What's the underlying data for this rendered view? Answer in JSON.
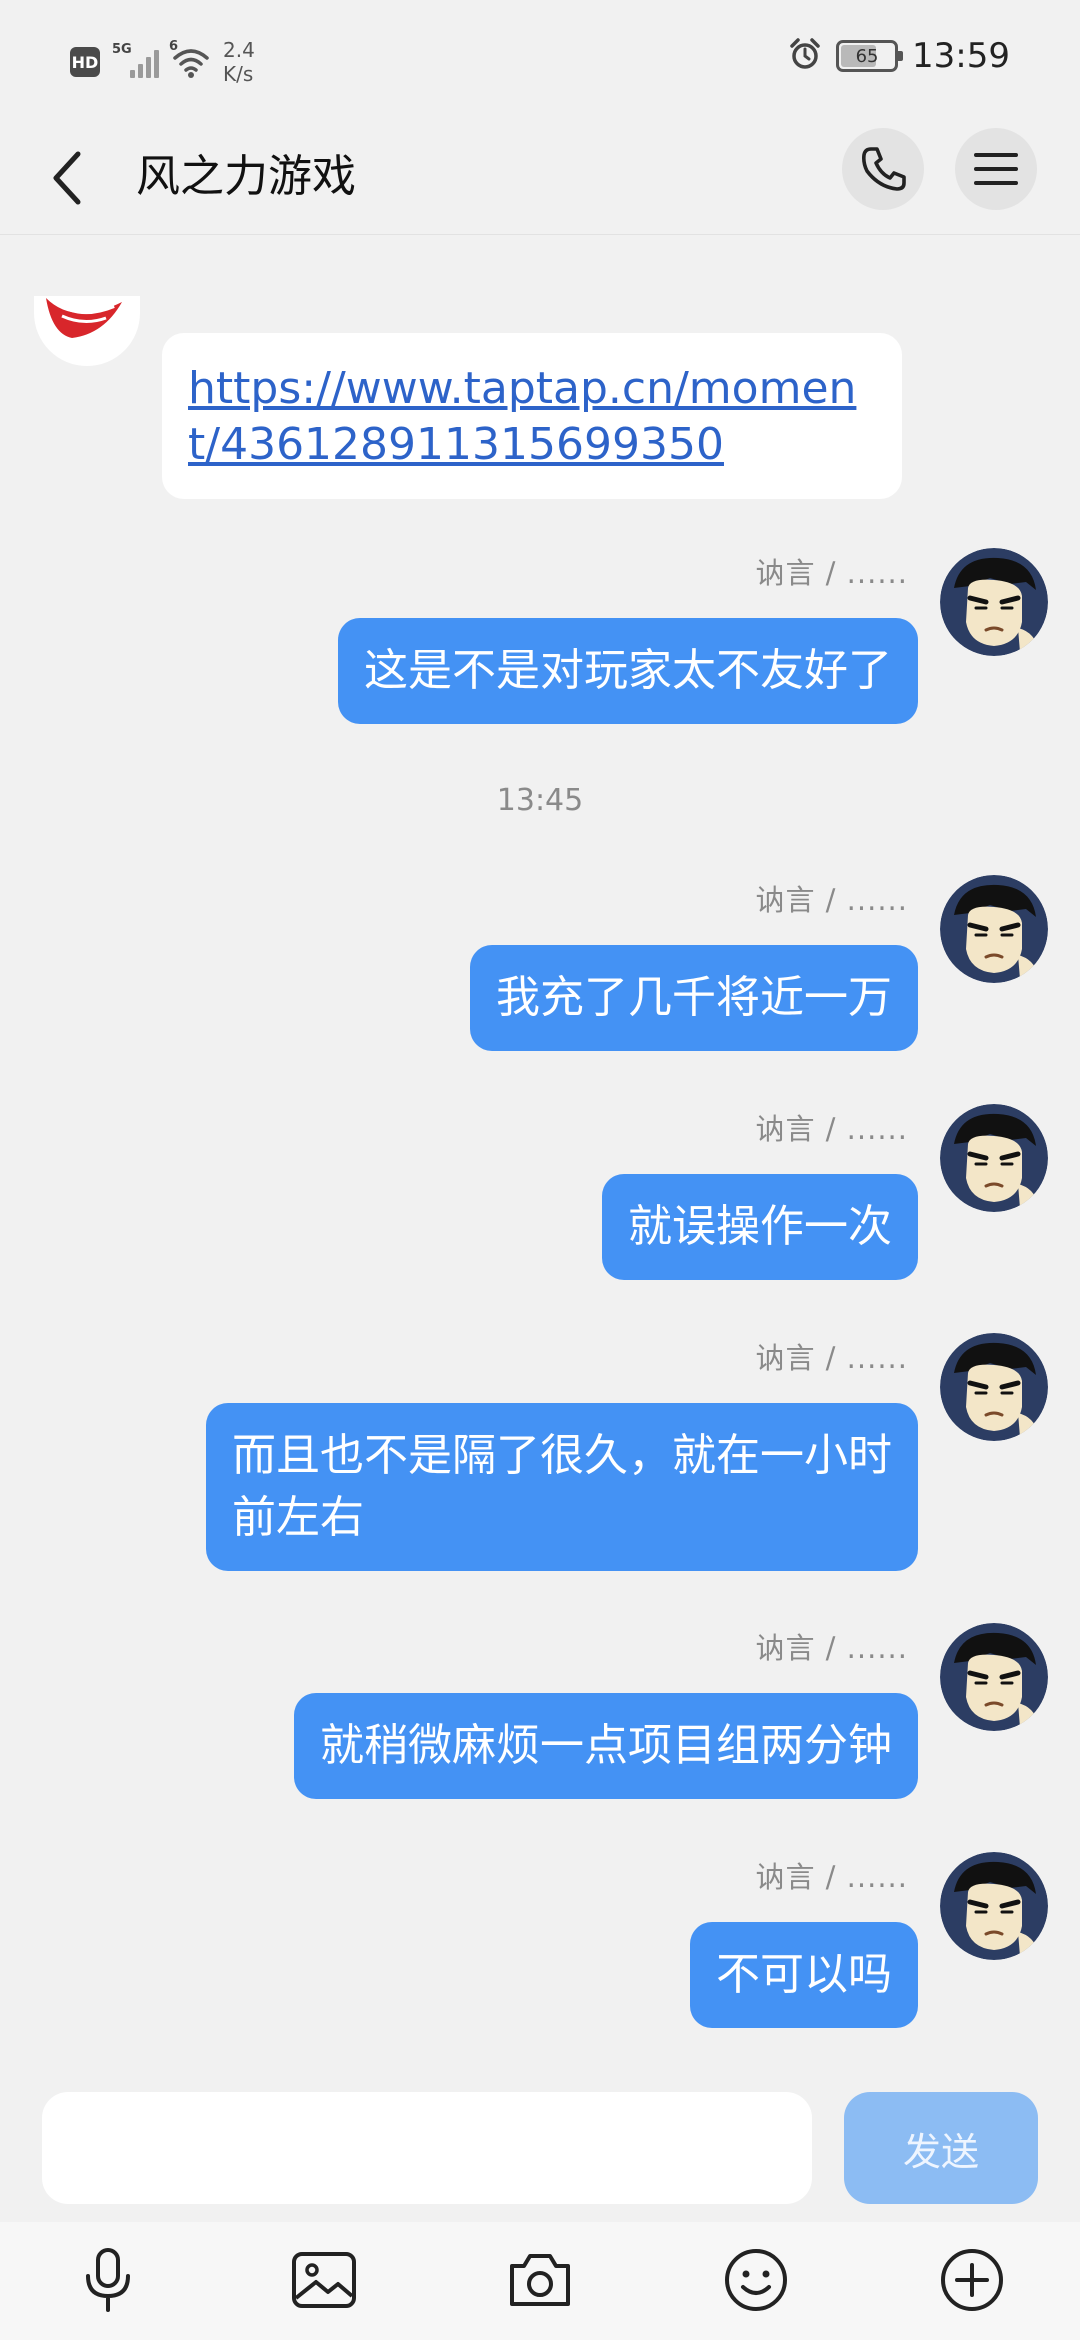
{
  "status_bar": {
    "hd": "HD",
    "network": "5G",
    "wifi_tag": "6",
    "speed_value": "2.4",
    "speed_unit": "K/s",
    "battery": "65",
    "time": "13:59"
  },
  "header": {
    "title": "风之力游戏",
    "icons": [
      "back-arrow-icon",
      "phone-icon",
      "menu-icon"
    ]
  },
  "incoming": {
    "link": "https://www.taptap.cn/moment/436128911315699350"
  },
  "messages": [
    {
      "sender": "讷言 / ......",
      "text": "这是不是对玩家太不友好了"
    },
    {
      "sender": "讷言 / ......",
      "text": "我充了几千将近一万"
    },
    {
      "sender": "讷言 / ......",
      "text": "就误操作一次"
    },
    {
      "sender": "讷言 / ......",
      "text": "而且也不是隔了很久，就在一小时\n前左右"
    },
    {
      "sender": "讷言 / ......",
      "text": "就稍微麻烦一点项目组两分钟"
    },
    {
      "sender": "讷言 / ......",
      "text": "不可以吗"
    }
  ],
  "timestamp": "13:45",
  "composer": {
    "value": "",
    "send_label": "发送"
  },
  "toolbar": {
    "icons": [
      "microphone-icon",
      "image-icon",
      "camera-icon",
      "emoji-icon",
      "plus-icon"
    ]
  },
  "colors": {
    "bubble_out": "#4492f4",
    "link": "#2d63c9",
    "send_disabled": "#8cbcf3",
    "background": "#f1f1f1"
  }
}
